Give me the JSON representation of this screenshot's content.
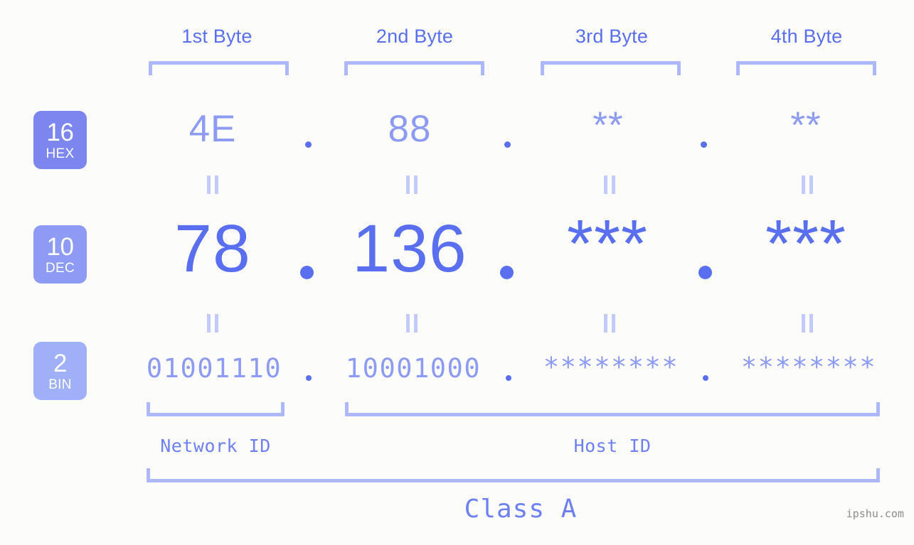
{
  "background_color": "#fcfdfa",
  "accent_colors": {
    "bracket": "#adb8fb",
    "header_text": "#5a6ff0",
    "hex_value": "#8d9bf4",
    "dec_value": "#5a6ff0",
    "bin_value": "#8d9bf4",
    "badge_hex": "#7b86ef",
    "badge_dec": "#8d9bf4",
    "badge_bin": "#9fb0f9",
    "eq_mark": "#c3cbfc",
    "watermark": "#8c8c8c"
  },
  "byte_headers": [
    {
      "label": "1st Byte"
    },
    {
      "label": "2nd Byte"
    },
    {
      "label": "3rd Byte"
    },
    {
      "label": "4th Byte"
    }
  ],
  "radix_badges": [
    {
      "base": "16",
      "name": "HEX"
    },
    {
      "base": "10",
      "name": "DEC"
    },
    {
      "base": "2",
      "name": "BIN"
    }
  ],
  "rows": {
    "hex": {
      "values": [
        "4E",
        "88",
        "**",
        "**"
      ],
      "separator": "."
    },
    "dec": {
      "values": [
        "78",
        "136",
        "***",
        "***"
      ],
      "separator": "."
    },
    "bin": {
      "values": [
        "01001110",
        "10001000",
        "********",
        "********"
      ],
      "separator": "."
    }
  },
  "equality_symbol": "||",
  "sections": {
    "network_id": "Network ID",
    "host_id": "Host ID",
    "class": "Class A"
  },
  "watermark": "ipshu.com"
}
